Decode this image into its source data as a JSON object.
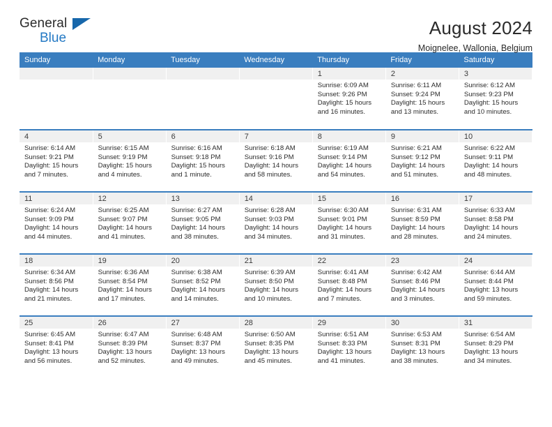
{
  "brand": {
    "name_part1": "General",
    "name_part2": "Blue",
    "accent_color": "#2479c4",
    "triangle_color": "#1767ab"
  },
  "header": {
    "title": "August 2024",
    "subtitle": "Moignelee, Wallonia, Belgium"
  },
  "calendar": {
    "header_bg": "#3a7ebf",
    "daynum_bg": "#f0f0f0",
    "weekday_headers": [
      "Sunday",
      "Monday",
      "Tuesday",
      "Wednesday",
      "Thursday",
      "Friday",
      "Saturday"
    ],
    "weeks": [
      [
        {
          "day": "",
          "sunrise": "",
          "sunset": "",
          "daylight1": "",
          "daylight2": ""
        },
        {
          "day": "",
          "sunrise": "",
          "sunset": "",
          "daylight1": "",
          "daylight2": ""
        },
        {
          "day": "",
          "sunrise": "",
          "sunset": "",
          "daylight1": "",
          "daylight2": ""
        },
        {
          "day": "",
          "sunrise": "",
          "sunset": "",
          "daylight1": "",
          "daylight2": ""
        },
        {
          "day": "1",
          "sunrise": "Sunrise: 6:09 AM",
          "sunset": "Sunset: 9:26 PM",
          "daylight1": "Daylight: 15 hours",
          "daylight2": "and 16 minutes."
        },
        {
          "day": "2",
          "sunrise": "Sunrise: 6:11 AM",
          "sunset": "Sunset: 9:24 PM",
          "daylight1": "Daylight: 15 hours",
          "daylight2": "and 13 minutes."
        },
        {
          "day": "3",
          "sunrise": "Sunrise: 6:12 AM",
          "sunset": "Sunset: 9:23 PM",
          "daylight1": "Daylight: 15 hours",
          "daylight2": "and 10 minutes."
        }
      ],
      [
        {
          "day": "4",
          "sunrise": "Sunrise: 6:14 AM",
          "sunset": "Sunset: 9:21 PM",
          "daylight1": "Daylight: 15 hours",
          "daylight2": "and 7 minutes."
        },
        {
          "day": "5",
          "sunrise": "Sunrise: 6:15 AM",
          "sunset": "Sunset: 9:19 PM",
          "daylight1": "Daylight: 15 hours",
          "daylight2": "and 4 minutes."
        },
        {
          "day": "6",
          "sunrise": "Sunrise: 6:16 AM",
          "sunset": "Sunset: 9:18 PM",
          "daylight1": "Daylight: 15 hours",
          "daylight2": "and 1 minute."
        },
        {
          "day": "7",
          "sunrise": "Sunrise: 6:18 AM",
          "sunset": "Sunset: 9:16 PM",
          "daylight1": "Daylight: 14 hours",
          "daylight2": "and 58 minutes."
        },
        {
          "day": "8",
          "sunrise": "Sunrise: 6:19 AM",
          "sunset": "Sunset: 9:14 PM",
          "daylight1": "Daylight: 14 hours",
          "daylight2": "and 54 minutes."
        },
        {
          "day": "9",
          "sunrise": "Sunrise: 6:21 AM",
          "sunset": "Sunset: 9:12 PM",
          "daylight1": "Daylight: 14 hours",
          "daylight2": "and 51 minutes."
        },
        {
          "day": "10",
          "sunrise": "Sunrise: 6:22 AM",
          "sunset": "Sunset: 9:11 PM",
          "daylight1": "Daylight: 14 hours",
          "daylight2": "and 48 minutes."
        }
      ],
      [
        {
          "day": "11",
          "sunrise": "Sunrise: 6:24 AM",
          "sunset": "Sunset: 9:09 PM",
          "daylight1": "Daylight: 14 hours",
          "daylight2": "and 44 minutes."
        },
        {
          "day": "12",
          "sunrise": "Sunrise: 6:25 AM",
          "sunset": "Sunset: 9:07 PM",
          "daylight1": "Daylight: 14 hours",
          "daylight2": "and 41 minutes."
        },
        {
          "day": "13",
          "sunrise": "Sunrise: 6:27 AM",
          "sunset": "Sunset: 9:05 PM",
          "daylight1": "Daylight: 14 hours",
          "daylight2": "and 38 minutes."
        },
        {
          "day": "14",
          "sunrise": "Sunrise: 6:28 AM",
          "sunset": "Sunset: 9:03 PM",
          "daylight1": "Daylight: 14 hours",
          "daylight2": "and 34 minutes."
        },
        {
          "day": "15",
          "sunrise": "Sunrise: 6:30 AM",
          "sunset": "Sunset: 9:01 PM",
          "daylight1": "Daylight: 14 hours",
          "daylight2": "and 31 minutes."
        },
        {
          "day": "16",
          "sunrise": "Sunrise: 6:31 AM",
          "sunset": "Sunset: 8:59 PM",
          "daylight1": "Daylight: 14 hours",
          "daylight2": "and 28 minutes."
        },
        {
          "day": "17",
          "sunrise": "Sunrise: 6:33 AM",
          "sunset": "Sunset: 8:58 PM",
          "daylight1": "Daylight: 14 hours",
          "daylight2": "and 24 minutes."
        }
      ],
      [
        {
          "day": "18",
          "sunrise": "Sunrise: 6:34 AM",
          "sunset": "Sunset: 8:56 PM",
          "daylight1": "Daylight: 14 hours",
          "daylight2": "and 21 minutes."
        },
        {
          "day": "19",
          "sunrise": "Sunrise: 6:36 AM",
          "sunset": "Sunset: 8:54 PM",
          "daylight1": "Daylight: 14 hours",
          "daylight2": "and 17 minutes."
        },
        {
          "day": "20",
          "sunrise": "Sunrise: 6:38 AM",
          "sunset": "Sunset: 8:52 PM",
          "daylight1": "Daylight: 14 hours",
          "daylight2": "and 14 minutes."
        },
        {
          "day": "21",
          "sunrise": "Sunrise: 6:39 AM",
          "sunset": "Sunset: 8:50 PM",
          "daylight1": "Daylight: 14 hours",
          "daylight2": "and 10 minutes."
        },
        {
          "day": "22",
          "sunrise": "Sunrise: 6:41 AM",
          "sunset": "Sunset: 8:48 PM",
          "daylight1": "Daylight: 14 hours",
          "daylight2": "and 7 minutes."
        },
        {
          "day": "23",
          "sunrise": "Sunrise: 6:42 AM",
          "sunset": "Sunset: 8:46 PM",
          "daylight1": "Daylight: 14 hours",
          "daylight2": "and 3 minutes."
        },
        {
          "day": "24",
          "sunrise": "Sunrise: 6:44 AM",
          "sunset": "Sunset: 8:44 PM",
          "daylight1": "Daylight: 13 hours",
          "daylight2": "and 59 minutes."
        }
      ],
      [
        {
          "day": "25",
          "sunrise": "Sunrise: 6:45 AM",
          "sunset": "Sunset: 8:41 PM",
          "daylight1": "Daylight: 13 hours",
          "daylight2": "and 56 minutes."
        },
        {
          "day": "26",
          "sunrise": "Sunrise: 6:47 AM",
          "sunset": "Sunset: 8:39 PM",
          "daylight1": "Daylight: 13 hours",
          "daylight2": "and 52 minutes."
        },
        {
          "day": "27",
          "sunrise": "Sunrise: 6:48 AM",
          "sunset": "Sunset: 8:37 PM",
          "daylight1": "Daylight: 13 hours",
          "daylight2": "and 49 minutes."
        },
        {
          "day": "28",
          "sunrise": "Sunrise: 6:50 AM",
          "sunset": "Sunset: 8:35 PM",
          "daylight1": "Daylight: 13 hours",
          "daylight2": "and 45 minutes."
        },
        {
          "day": "29",
          "sunrise": "Sunrise: 6:51 AM",
          "sunset": "Sunset: 8:33 PM",
          "daylight1": "Daylight: 13 hours",
          "daylight2": "and 41 minutes."
        },
        {
          "day": "30",
          "sunrise": "Sunrise: 6:53 AM",
          "sunset": "Sunset: 8:31 PM",
          "daylight1": "Daylight: 13 hours",
          "daylight2": "and 38 minutes."
        },
        {
          "day": "31",
          "sunrise": "Sunrise: 6:54 AM",
          "sunset": "Sunset: 8:29 PM",
          "daylight1": "Daylight: 13 hours",
          "daylight2": "and 34 minutes."
        }
      ]
    ]
  }
}
